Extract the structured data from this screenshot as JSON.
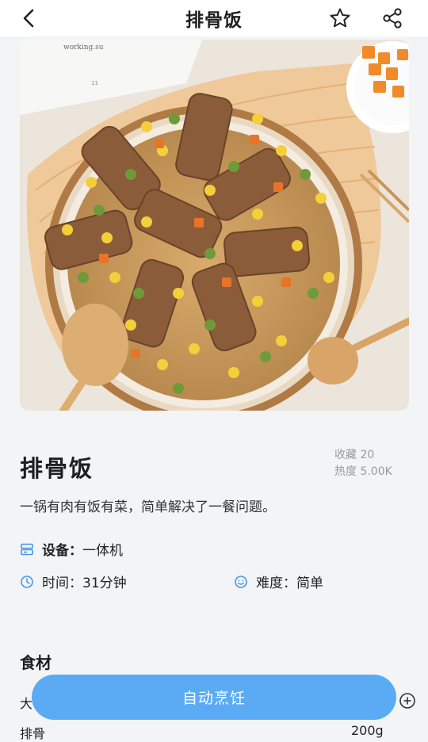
{
  "header": {
    "title": "排骨饭"
  },
  "hero": {
    "page_text": "working.su",
    "page_number": "11"
  },
  "dish": {
    "name": "排骨饭",
    "favorites": "收藏 20",
    "heat": "热度 5.00K",
    "description": "一锅有肉有饭有菜，简单解决了一餐问题。"
  },
  "meta": {
    "device_label": "设备：",
    "device_value": "一体机",
    "time_label": "时间：",
    "time_value": "31分钟",
    "difficulty_label": "难度：",
    "difficulty_value": "简单"
  },
  "ingredients": {
    "title": "食材",
    "items": [
      {
        "name": "大",
        "amount": ""
      },
      {
        "name": "排骨",
        "amount": "200g"
      }
    ]
  },
  "cta": {
    "label": "自动烹饪"
  },
  "colors": {
    "accent": "#5aabf4",
    "icon_blue": "#4a97e8"
  },
  "icons": [
    "back-icon",
    "star-icon",
    "share-icon",
    "device-icon",
    "clock-icon",
    "smile-icon",
    "plus-circle-icon"
  ]
}
